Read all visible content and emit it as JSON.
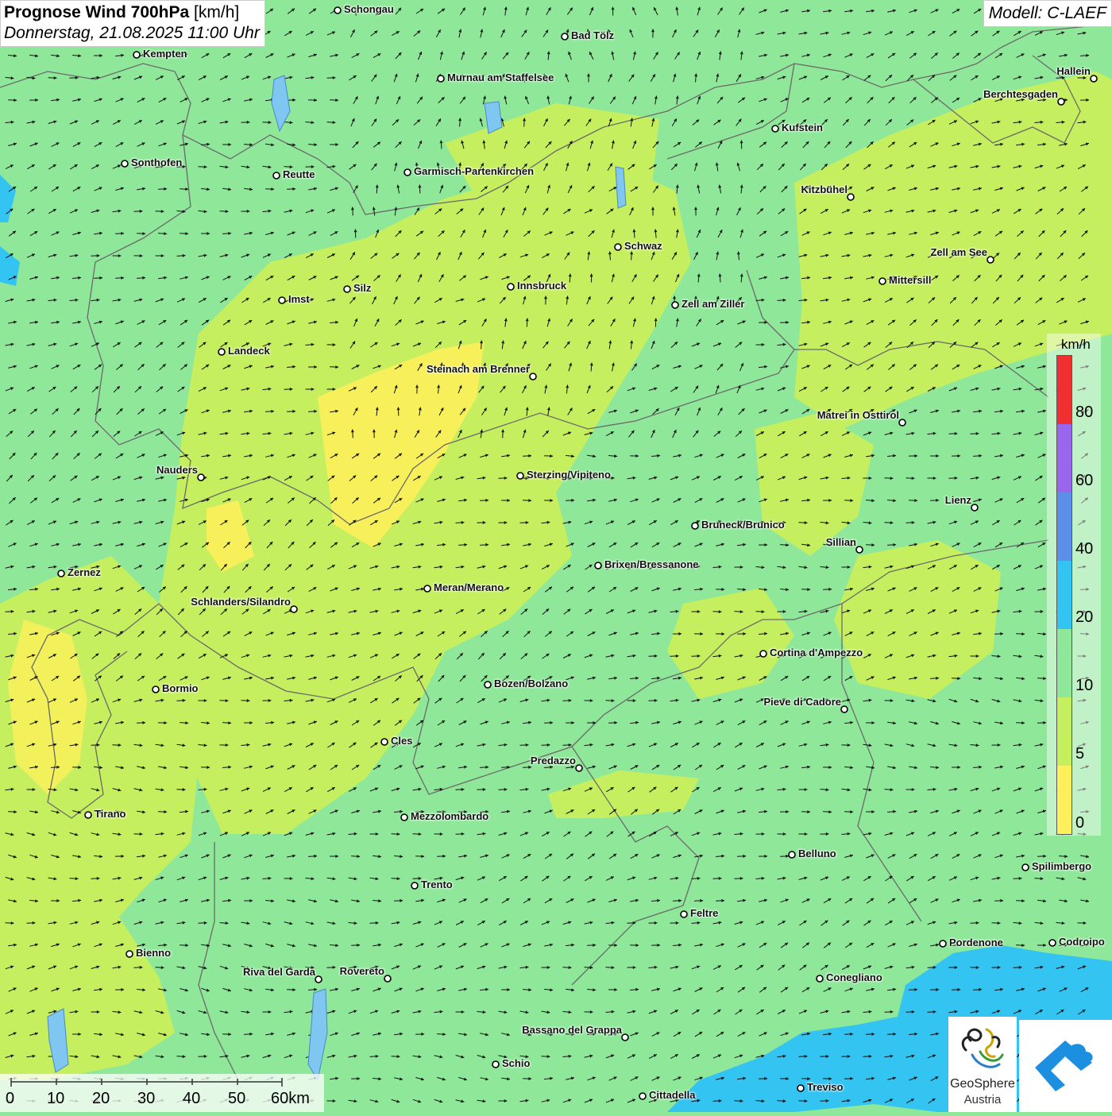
{
  "header": {
    "title_bold": "Prognose Wind 700hPa",
    "title_unit": "[km/h]",
    "datetime": "Donnerstag, 21.08.2025 11:00 Uhr",
    "model": "Modell: C-LAEF"
  },
  "legend": {
    "unit": "km/h",
    "ticks": [
      "80",
      "60",
      "40",
      "20",
      "10",
      "5",
      "0"
    ],
    "colors": [
      "#f03030",
      "#9966ee",
      "#5c8fe8",
      "#33c4f2",
      "#8fe89a",
      "#c6ef5f",
      "#fdf05a"
    ]
  },
  "scalebar": {
    "labels": [
      "0",
      "10",
      "20",
      "30",
      "40",
      "50",
      "60km"
    ]
  },
  "logos": {
    "geosphere_line1": "GeoSphere",
    "geosphere_line2": "Austria"
  },
  "cities": [
    {
      "name": "Schongau"
    },
    {
      "name": "Bad Tölz"
    },
    {
      "name": "Kempten"
    },
    {
      "name": "Murnau am Staffelsee"
    },
    {
      "name": "Hallein"
    },
    {
      "name": "Berchtesgaden"
    },
    {
      "name": "Kufstein"
    },
    {
      "name": "Sonthofen"
    },
    {
      "name": "Reutte"
    },
    {
      "name": "Garmisch-Partenkirchen"
    },
    {
      "name": "Kitzbühel"
    },
    {
      "name": "Schwaz"
    },
    {
      "name": "Zell am See"
    },
    {
      "name": "Mittersill"
    },
    {
      "name": "Innsbruck"
    },
    {
      "name": "Silz"
    },
    {
      "name": "Imst"
    },
    {
      "name": "Zell am Ziller"
    },
    {
      "name": "Landeck"
    },
    {
      "name": "Steinach am Brenner"
    },
    {
      "name": "Matrei in Osttirol"
    },
    {
      "name": "Nauders"
    },
    {
      "name": "Sterzing/Vipiteno"
    },
    {
      "name": "Lienz"
    },
    {
      "name": "Bruneck/Brunico"
    },
    {
      "name": "Sillian"
    },
    {
      "name": "Zernez"
    },
    {
      "name": "Brixen/Bressanone"
    },
    {
      "name": "Meran/Merano"
    },
    {
      "name": "Schlanders/Silandro"
    },
    {
      "name": "Cortina d'Ampezzo"
    },
    {
      "name": "Bormio"
    },
    {
      "name": "Bozen/Bolzano"
    },
    {
      "name": "Pieve di Cadore"
    },
    {
      "name": "Cles"
    },
    {
      "name": "Predazzo"
    },
    {
      "name": "Tirano"
    },
    {
      "name": "Mezzolombardo"
    },
    {
      "name": "Belluno"
    },
    {
      "name": "Spilimbergo"
    },
    {
      "name": "Trento"
    },
    {
      "name": "Feltre"
    },
    {
      "name": "Pordenone"
    },
    {
      "name": "Codroipo"
    },
    {
      "name": "Bienno"
    },
    {
      "name": "Riva del Garda"
    },
    {
      "name": "Rovereto"
    },
    {
      "name": "Conegliano"
    },
    {
      "name": "Bassano del Grappa"
    },
    {
      "name": "Schio"
    },
    {
      "name": "Treviso"
    },
    {
      "name": "Cittadella"
    }
  ]
}
